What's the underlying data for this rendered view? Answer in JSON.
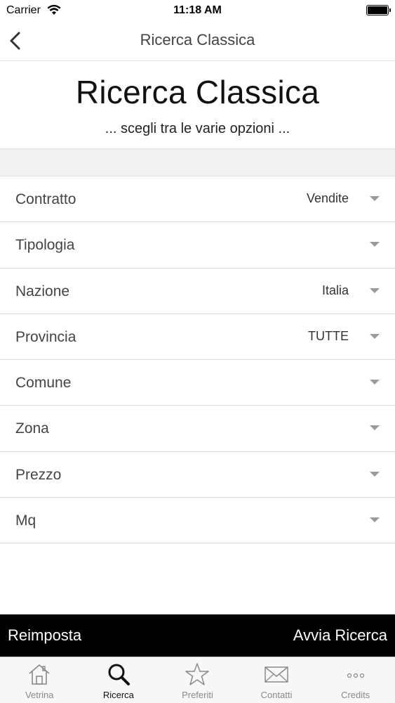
{
  "status_bar": {
    "carrier": "Carrier",
    "time": "11:18 AM"
  },
  "nav": {
    "title": "Ricerca Classica"
  },
  "header": {
    "title": "Ricerca Classica",
    "subtitle": "... scegli tra le varie opzioni ..."
  },
  "form": {
    "rows": [
      {
        "label": "Contratto",
        "value": "Vendite"
      },
      {
        "label": "Tipologia",
        "value": ""
      },
      {
        "label": "Nazione",
        "value": "Italia"
      },
      {
        "label": "Provincia",
        "value": "TUTTE"
      },
      {
        "label": "Comune",
        "value": ""
      },
      {
        "label": "Zona",
        "value": ""
      },
      {
        "label": "Prezzo",
        "value": ""
      },
      {
        "label": "Mq",
        "value": ""
      }
    ]
  },
  "actions": {
    "reset_label": "Reimposta",
    "search_label": "Avvia Ricerca"
  },
  "tabs": [
    {
      "label": "Vetrina",
      "icon": "home-icon"
    },
    {
      "label": "Ricerca",
      "icon": "search-icon",
      "active": true
    },
    {
      "label": "Preferiti",
      "icon": "star-icon"
    },
    {
      "label": "Contatti",
      "icon": "mail-icon"
    },
    {
      "label": "Credits",
      "icon": "more-icon"
    }
  ],
  "colors": {
    "action_bar": "#000000",
    "tab_active": "#111111",
    "tab_inactive": "#8a8a8a"
  }
}
